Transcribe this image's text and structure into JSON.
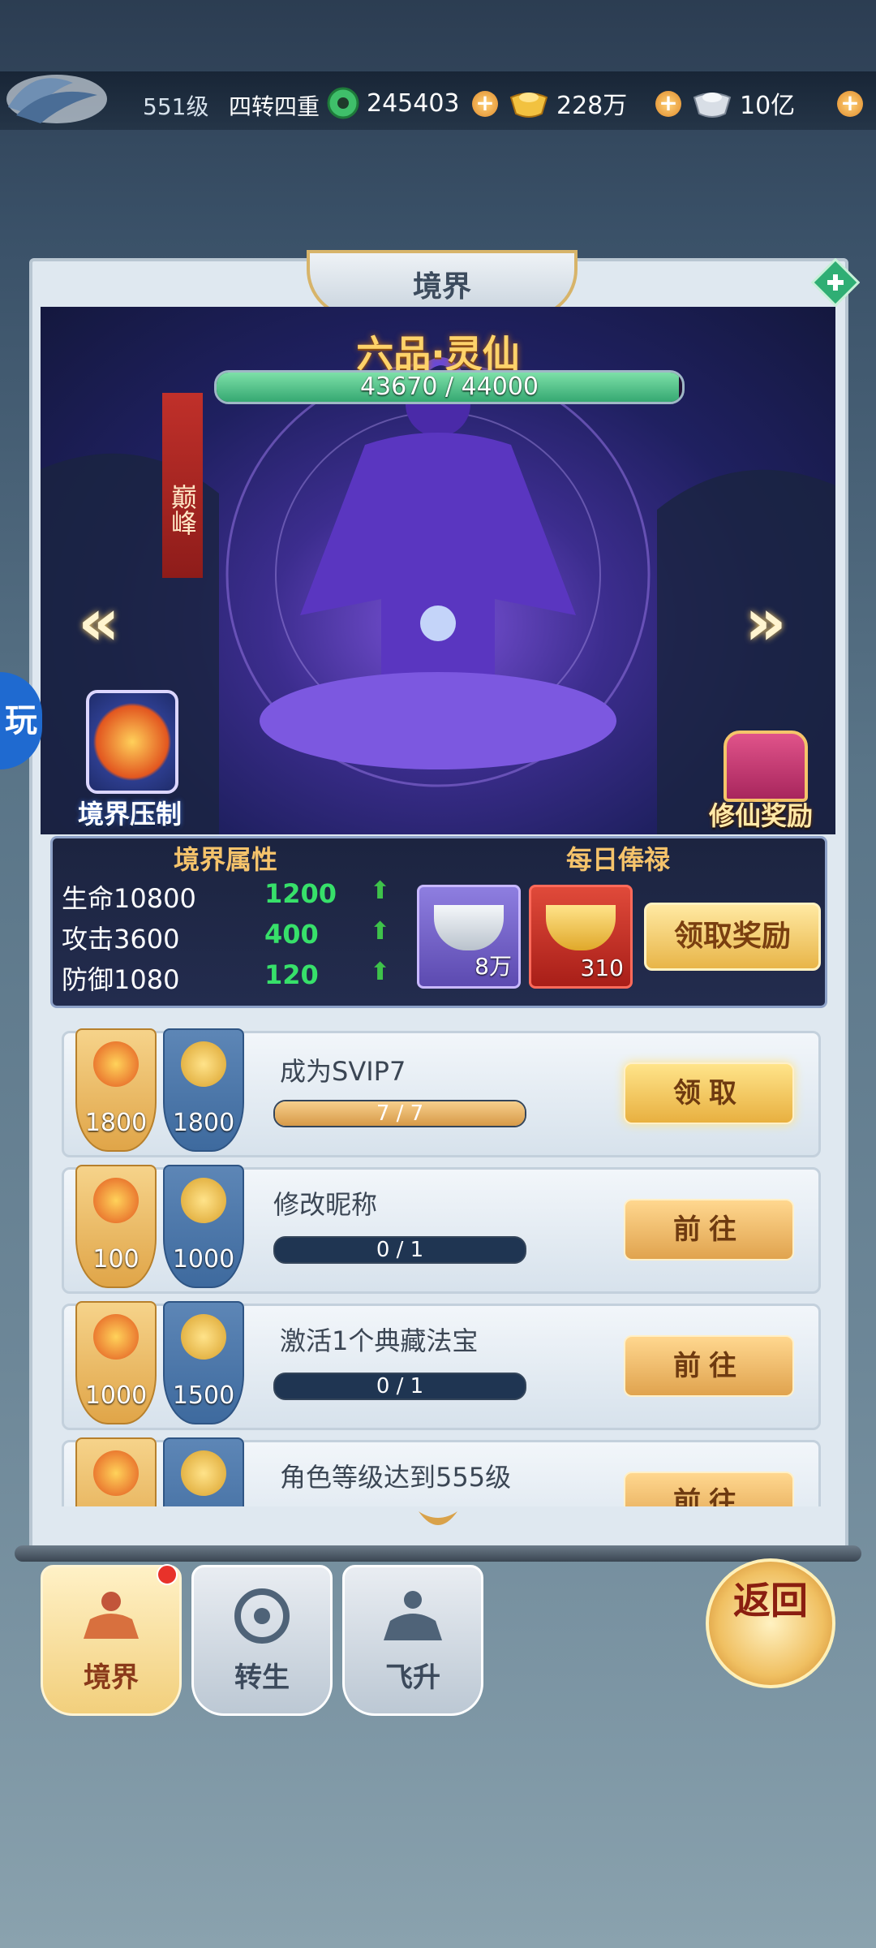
{
  "topbar": {
    "level": "551级",
    "turn": "四转四重",
    "jade": "245403",
    "gold": "228万",
    "silver": "10亿"
  },
  "panel": {
    "title": "境界",
    "realm_name": "六品·灵仙",
    "exp_text": "43670 / 44000",
    "exp_progress": 0.9925,
    "peak": "巅峰",
    "side_tab": "玩",
    "suppress_label": "境界压制",
    "reward_label": "修仙奖励"
  },
  "attributes": {
    "header_left": "境界属性",
    "header_right": "每日俸禄",
    "rows": [
      {
        "label": "生命10800",
        "inc": "1200"
      },
      {
        "label": "攻击3600",
        "inc": "400"
      },
      {
        "label": "防御1080",
        "inc": "120"
      }
    ],
    "salary": [
      {
        "icon": "silver-ingot-icon",
        "count": "8万"
      },
      {
        "icon": "gold-ingot-icon",
        "count": "310"
      }
    ],
    "claim_label": "领取奖励"
  },
  "tasks": [
    {
      "fire": "1800",
      "gold": "1800",
      "name": "成为SVIP7",
      "progress_text": "7 / 7",
      "progress": 1.0,
      "button": "领取"
    },
    {
      "fire": "100",
      "gold": "1000",
      "name": "修改昵称",
      "progress_text": "0 / 1",
      "progress": 0.0,
      "button": "前往"
    },
    {
      "fire": "1000",
      "gold": "1500",
      "name": "激活1个典藏法宝",
      "progress_text": "0 / 1",
      "progress": 0.0,
      "button": "前往"
    },
    {
      "fire": "",
      "gold": "",
      "name": "角色等级达到555级",
      "progress_text": "",
      "progress": 0.0,
      "button": "前往"
    }
  ],
  "bottom": {
    "tabs": [
      "境界",
      "转生",
      "飞升"
    ],
    "back": "返回"
  },
  "colors": {
    "accent_gold": "#f5c36b",
    "increase_green": "#37e06a",
    "exp_green": "#35a872"
  }
}
